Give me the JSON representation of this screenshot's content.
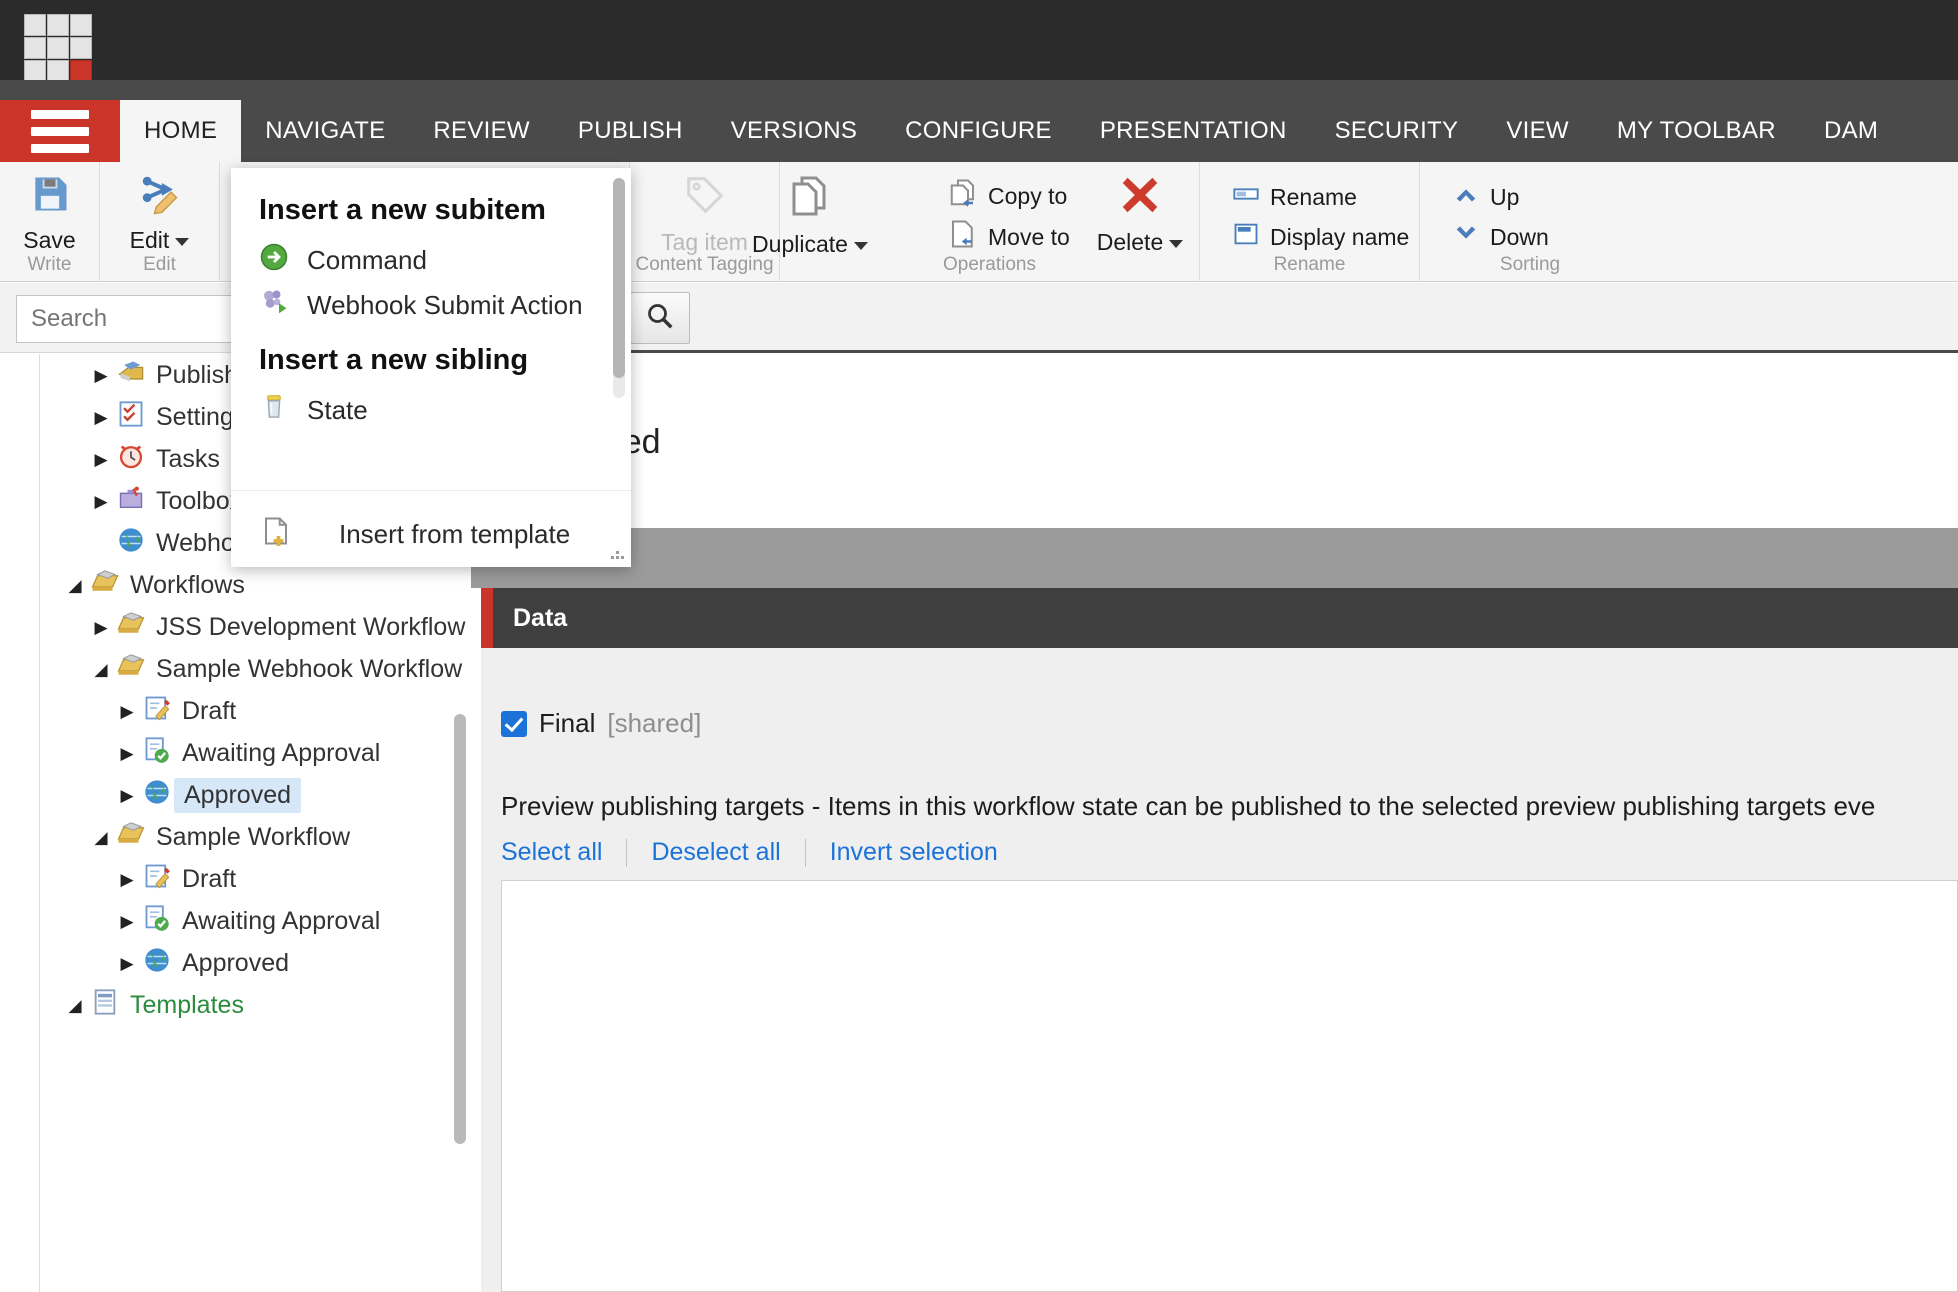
{
  "app": {
    "logo_name": "sitecore-logo",
    "accent_color": "#cb3529"
  },
  "nav": {
    "menu_icon": "hamburger-menu-icon",
    "tabs": [
      {
        "label": "HOME",
        "active": true
      },
      {
        "label": "NAVIGATE",
        "active": false
      },
      {
        "label": "REVIEW",
        "active": false
      },
      {
        "label": "PUBLISH",
        "active": false
      },
      {
        "label": "VERSIONS",
        "active": false
      },
      {
        "label": "CONFIGURE",
        "active": false
      },
      {
        "label": "PRESENTATION",
        "active": false
      },
      {
        "label": "SECURITY",
        "active": false
      },
      {
        "label": "VIEW",
        "active": false
      },
      {
        "label": "MY TOOLBAR",
        "active": false
      },
      {
        "label": "DAM",
        "active": false
      }
    ]
  },
  "ribbon": {
    "groups": [
      {
        "label": "Write"
      },
      {
        "label": "Edit"
      },
      {
        "label": "Content Tagging"
      },
      {
        "label": "Operations"
      },
      {
        "label": "Rename"
      },
      {
        "label": "Sorting"
      }
    ],
    "save_label": "Save",
    "edit_label": "Edit",
    "tag_item_label": "Tag item",
    "duplicate_label": "Duplicate",
    "copy_to_label": "Copy to",
    "move_to_label": "Move to",
    "delete_label": "Delete",
    "rename_label": "Rename",
    "display_name_label": "Display name",
    "up_label": "Up",
    "down_label": "Down"
  },
  "popup": {
    "subitem_heading": "Insert a new subitem",
    "subitem_options": [
      {
        "label": "Command",
        "icon": "green-arrow-icon"
      },
      {
        "label": "Webhook Submit Action",
        "icon": "webhook-action-icon"
      }
    ],
    "sibling_heading": "Insert a new sibling",
    "sibling_options": [
      {
        "label": "State",
        "icon": "state-jar-icon"
      }
    ],
    "insert_from_template_label": "Insert from template"
  },
  "sidebar": {
    "search_placeholder": "Search",
    "tree": [
      {
        "label": "Publishing",
        "icon": "publishing-icon",
        "indent": 0,
        "twist": "collapsed",
        "state": "normal"
      },
      {
        "label": "Settings",
        "icon": "settings-icon",
        "indent": 0,
        "twist": "collapsed",
        "state": "normal"
      },
      {
        "label": "Tasks",
        "icon": "tasks-clock-icon",
        "indent": 0,
        "twist": "collapsed",
        "state": "normal"
      },
      {
        "label": "Toolbox",
        "icon": "toolbox-icon",
        "indent": 0,
        "twist": "collapsed",
        "state": "normal"
      },
      {
        "label": "Webhooks",
        "icon": "globe-icon",
        "indent": 0,
        "twist": "none",
        "state": "normal"
      },
      {
        "label": "Workflows",
        "icon": "workflow-folder-icon",
        "indent": 0,
        "twist": "expanded",
        "state": "normal"
      },
      {
        "label": "JSS Development Workflow",
        "icon": "workflow-folder-icon",
        "indent": 1,
        "twist": "collapsed",
        "state": "normal"
      },
      {
        "label": "Sample Webhook Workflow",
        "icon": "workflow-folder-icon",
        "indent": 1,
        "twist": "expanded",
        "state": "normal"
      },
      {
        "label": "Draft",
        "icon": "draft-pencil-icon",
        "indent": 2,
        "twist": "collapsed",
        "state": "normal"
      },
      {
        "label": "Awaiting Approval",
        "icon": "awaiting-approval-icon",
        "indent": 2,
        "twist": "collapsed",
        "state": "normal"
      },
      {
        "label": "Approved",
        "icon": "globe-icon",
        "indent": 2,
        "twist": "collapsed",
        "state": "selected"
      },
      {
        "label": "Sample Workflow",
        "icon": "workflow-folder-icon",
        "indent": 1,
        "twist": "expanded",
        "state": "normal"
      },
      {
        "label": "Draft",
        "icon": "draft-pencil-icon",
        "indent": 2,
        "twist": "collapsed",
        "state": "normal"
      },
      {
        "label": "Awaiting Approval",
        "icon": "awaiting-approval-icon",
        "indent": 2,
        "twist": "collapsed",
        "state": "normal"
      },
      {
        "label": "Approved",
        "icon": "globe-icon",
        "indent": 2,
        "twist": "collapsed",
        "state": "normal"
      },
      {
        "label": "Templates",
        "icon": "templates-icon",
        "indent": 0,
        "twist": "expanded",
        "state": "green"
      }
    ]
  },
  "main": {
    "search_icon": "magnifier-icon",
    "item_title": "Approved",
    "section_title": "Data",
    "final_label": "Final",
    "final_shared": "[shared]",
    "field_description": "Preview publishing targets - Items in this workflow state can be published to the selected preview publishing targets eve",
    "select_all_label": "Select all",
    "deselect_all_label": "Deselect all",
    "invert_selection_label": "Invert selection"
  }
}
